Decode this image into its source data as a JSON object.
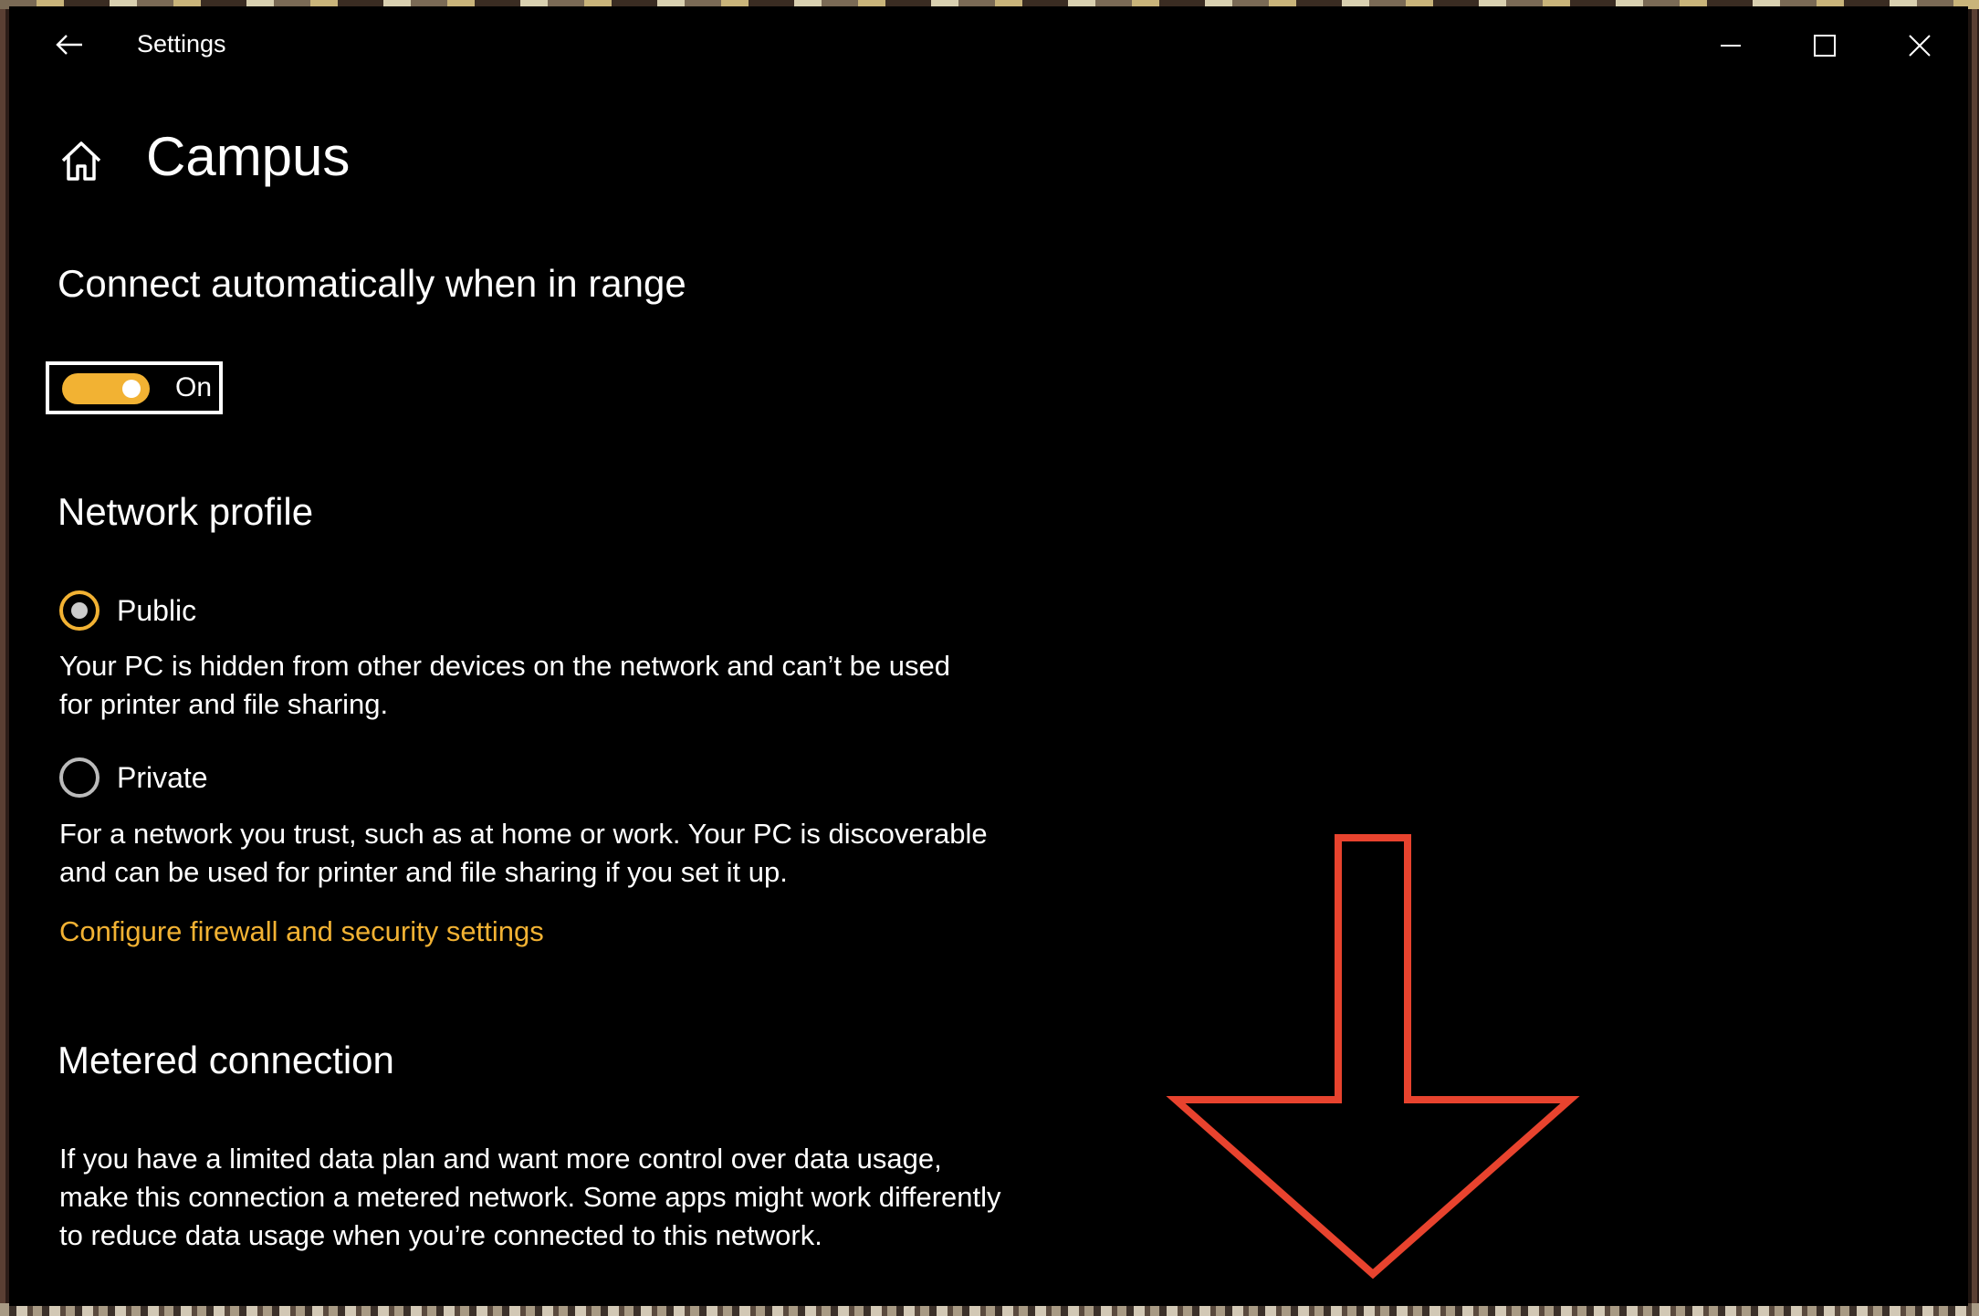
{
  "window": {
    "title": "Settings"
  },
  "page": {
    "title": "Campus"
  },
  "auto_connect": {
    "heading": "Connect automatically when in range",
    "toggle_state": "On",
    "is_on": true
  },
  "network_profile": {
    "heading": "Network profile",
    "options": [
      {
        "label": "Public",
        "selected": true,
        "description": "Your PC is hidden from other devices on the network and can’t be used for printer and file sharing."
      },
      {
        "label": "Private",
        "selected": false,
        "description": "For a network you trust, such as at home or work. Your PC is discoverable and can be used for printer and file sharing if you set it up."
      }
    ],
    "link": "Configure firewall and security settings"
  },
  "metered": {
    "heading": "Metered connection",
    "description": "If you have a limited data plan and want more control over data usage, make this connection a metered network. Some apps might work differently to reduce data usage when you’re connected to this network."
  },
  "colors": {
    "accent": "#f2b233",
    "background": "#000000",
    "annotation_arrow": "#e8432e"
  },
  "icons": {
    "back": "back-arrow-icon",
    "home": "home-icon",
    "minimize": "minimize-icon",
    "maximize": "maximize-icon",
    "close": "close-icon",
    "annotation": "down-arrow-annotation"
  }
}
